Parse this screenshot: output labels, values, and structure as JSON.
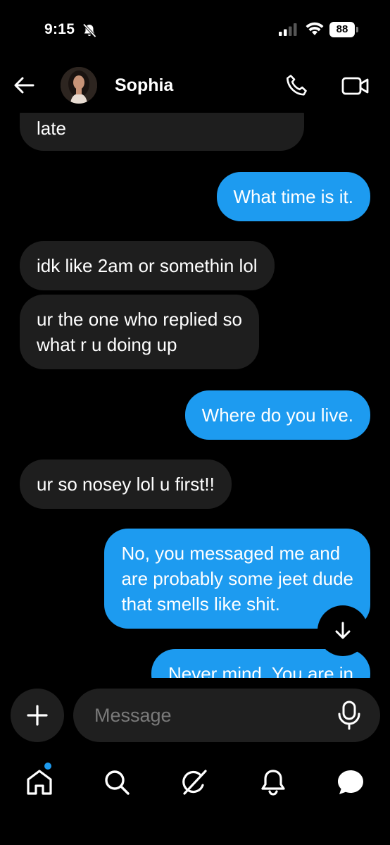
{
  "status_bar": {
    "time": "9:15",
    "battery": "88"
  },
  "header": {
    "contact_name": "Sophia",
    "icons": [
      "back-arrow-icon",
      "phone-icon",
      "video-icon"
    ]
  },
  "messages": [
    {
      "direction": "incoming",
      "lines": [
        "late"
      ]
    },
    {
      "direction": "outgoing",
      "lines": [
        "What time is it."
      ]
    },
    {
      "direction": "incoming",
      "lines": [
        "idk like 2am or somethin lol"
      ]
    },
    {
      "direction": "incoming",
      "lines": [
        "ur the one who replied so",
        "what r u doing up"
      ]
    },
    {
      "direction": "outgoing",
      "lines": [
        "Where do you live."
      ]
    },
    {
      "direction": "incoming",
      "lines": [
        "ur so nosey lol u first!!"
      ]
    },
    {
      "direction": "outgoing",
      "lines": [
        "No, you messaged me and",
        "are probably some jeet dude",
        "that smells like shit."
      ]
    },
    {
      "direction": "outgoing",
      "lines": [
        "Never mind. You are in"
      ]
    }
  ],
  "composer": {
    "placeholder": "Message"
  },
  "nav": [
    "home-icon",
    "search-icon",
    "grok-icon",
    "notifications-icon",
    "messages-icon"
  ],
  "colors": {
    "background": "#000000",
    "outgoing_bubble": "#1d9bf0",
    "incoming_bubble": "#1e1e1e",
    "placeholder": "#7a7a7a"
  }
}
